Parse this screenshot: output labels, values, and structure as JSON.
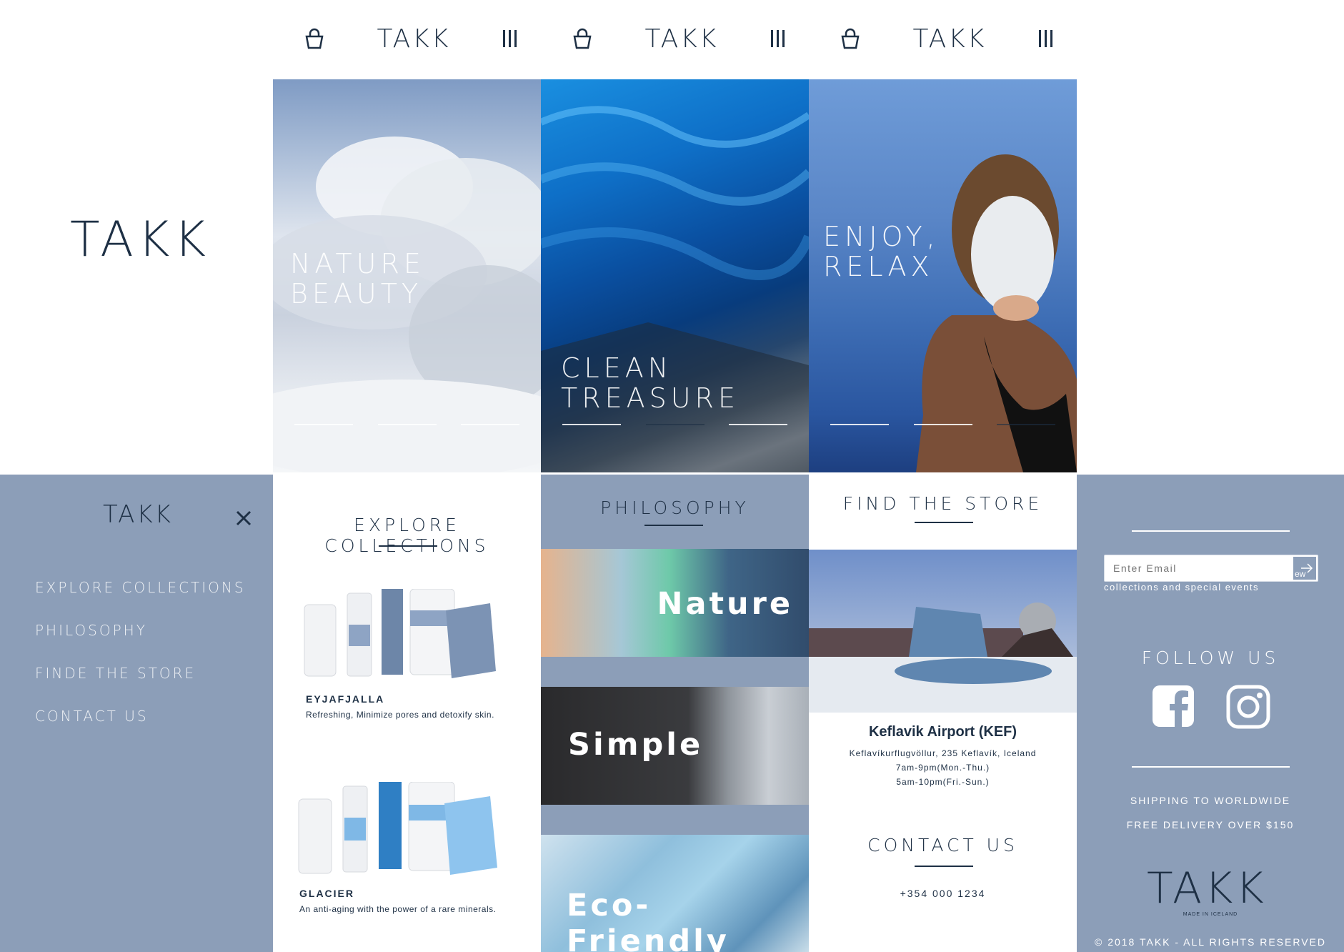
{
  "brand": "TAKK",
  "topnav": [
    {
      "brand": "TAKK"
    },
    {
      "brand": "TAKK"
    },
    {
      "brand": "TAKK"
    }
  ],
  "hero": [
    {
      "title": "Nature\nBeauty"
    },
    {
      "title": "Clean\nTreasure"
    },
    {
      "title": "Enjoy,\nRelax"
    }
  ],
  "menu": {
    "brand": "TAKK",
    "close_icon": "close-icon",
    "items": [
      {
        "label": "Explore Collections"
      },
      {
        "label": "Philosophy"
      },
      {
        "label": "Finde the Store"
      },
      {
        "label": "Contact us"
      }
    ]
  },
  "collections": {
    "title": "Explore Collections",
    "products": [
      {
        "name": "EYJAFJALLA",
        "desc": "Refreshing, Minimize pores and detoxify skin."
      },
      {
        "name": "GLACIER",
        "desc": "An anti-aging with the power of a rare minerals."
      }
    ]
  },
  "philosophy": {
    "title": "Philosophy",
    "tiles": [
      {
        "label": "Nature"
      },
      {
        "label": "Simple"
      },
      {
        "label": "Eco-Friendly"
      }
    ]
  },
  "store": {
    "title": "Find the Store",
    "name": "Keflavik Airport (KEF)",
    "address": "Keflavíkurflugvöllur, 235 Keflavík, Iceland",
    "hours_weekday": "7am-9pm(Mon.-Thu.)",
    "hours_weekend": "5am-10pm(Fri.-Sun.)",
    "contact_title": "Contact us",
    "phone": "+354 000 1234"
  },
  "footer": {
    "email_placeholder": "Enter Email",
    "email_button": "ew",
    "newsletter_note": "collections and special events",
    "follow_title": "Follow us",
    "shipping": "SHIPPING TO WORLDWIDE",
    "delivery": "FREE DELIVERY OVER $150",
    "logo": "TAKK",
    "logo_sub": "MADE IN ICELAND",
    "copyright": "© 2018 TAKK - ALL RIGHTS RESERVED"
  },
  "colors": {
    "navy": "#1e3045",
    "slate_blue": "#8c9eb8"
  }
}
